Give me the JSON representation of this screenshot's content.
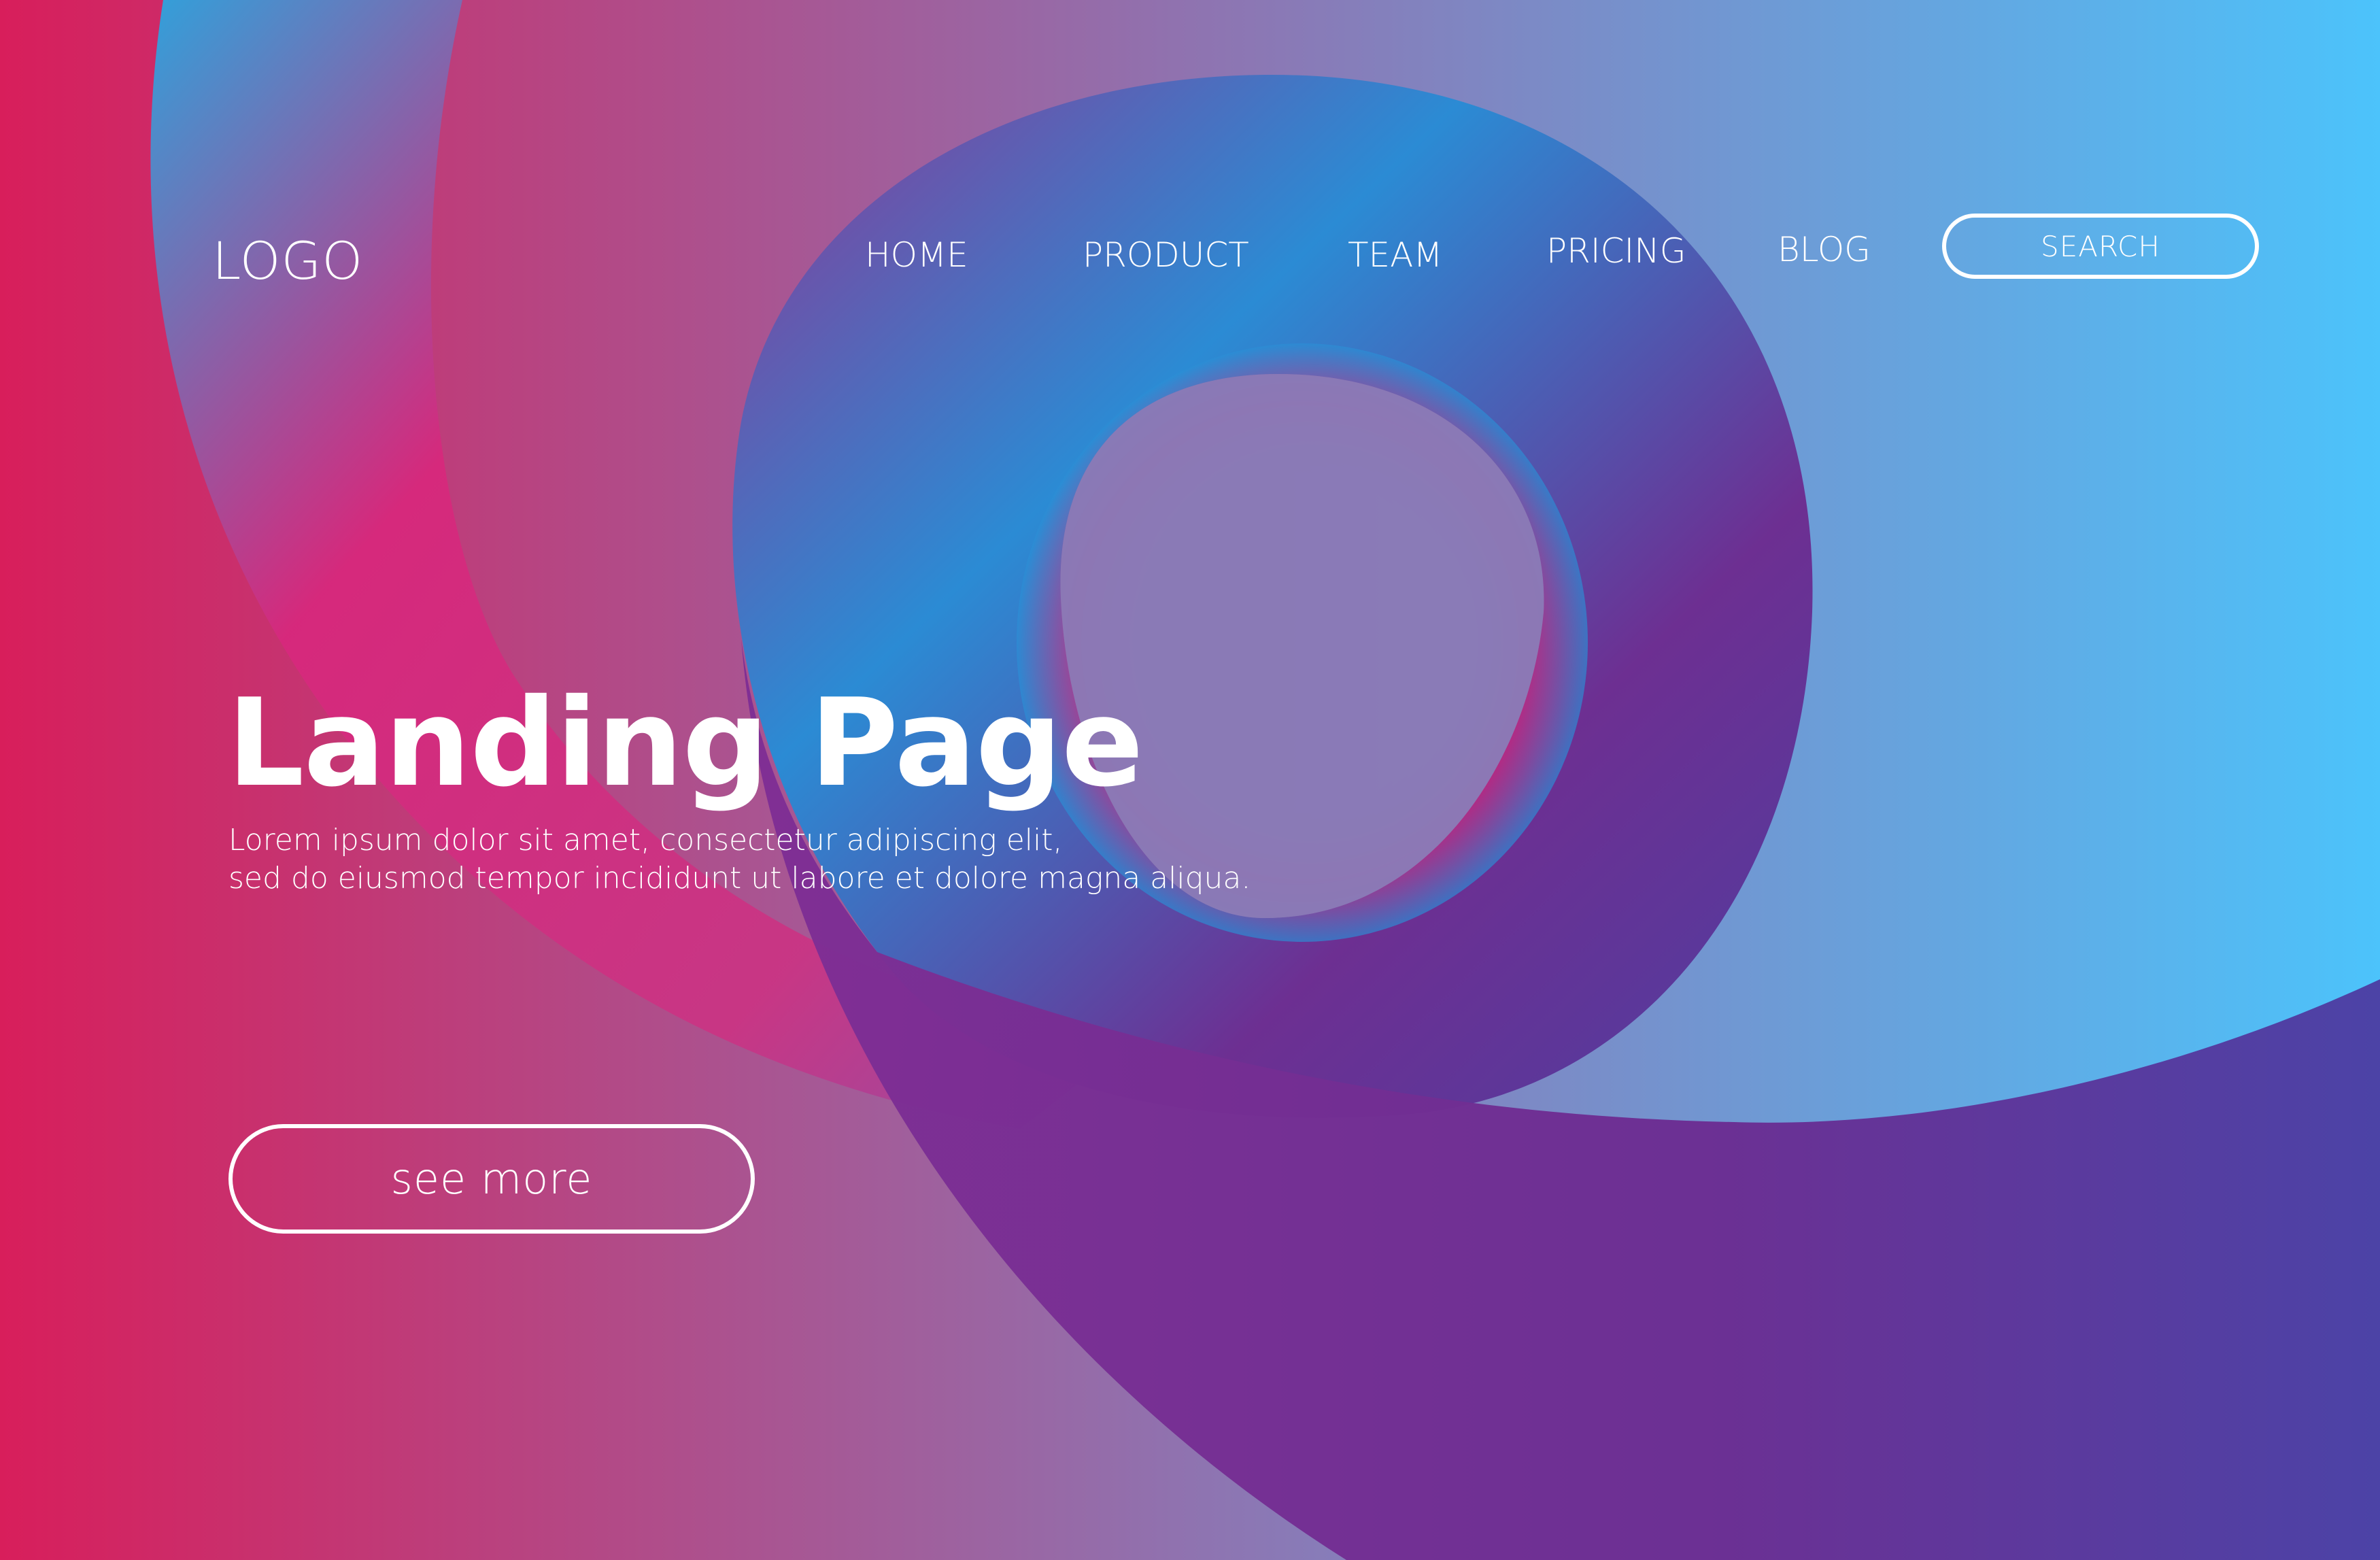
{
  "header": {
    "logo_text": "LOGO",
    "nav": [
      {
        "label": "HOME"
      },
      {
        "label": "PRODUCT"
      },
      {
        "label": "TEAM"
      },
      {
        "label": "PRICING"
      },
      {
        "label": "BLOG"
      }
    ],
    "search_label": "SEARCH"
  },
  "hero": {
    "title": "Landing Page",
    "body_line_1": "Lorem ipsum dolor sit amet, consectetur adipiscing elit,",
    "body_line_2": "sed do eiusmod tempor incididunt ut labore et dolore magna aliqua.",
    "cta_label": "see more"
  },
  "colors": {
    "background_left": "#d81e5b",
    "background_right": "#4cc3fb",
    "ring_blue": "#2a8fd6",
    "ring_purple": "#7b2d91",
    "ring_pink": "#d7287c",
    "text": "#ffffff"
  }
}
